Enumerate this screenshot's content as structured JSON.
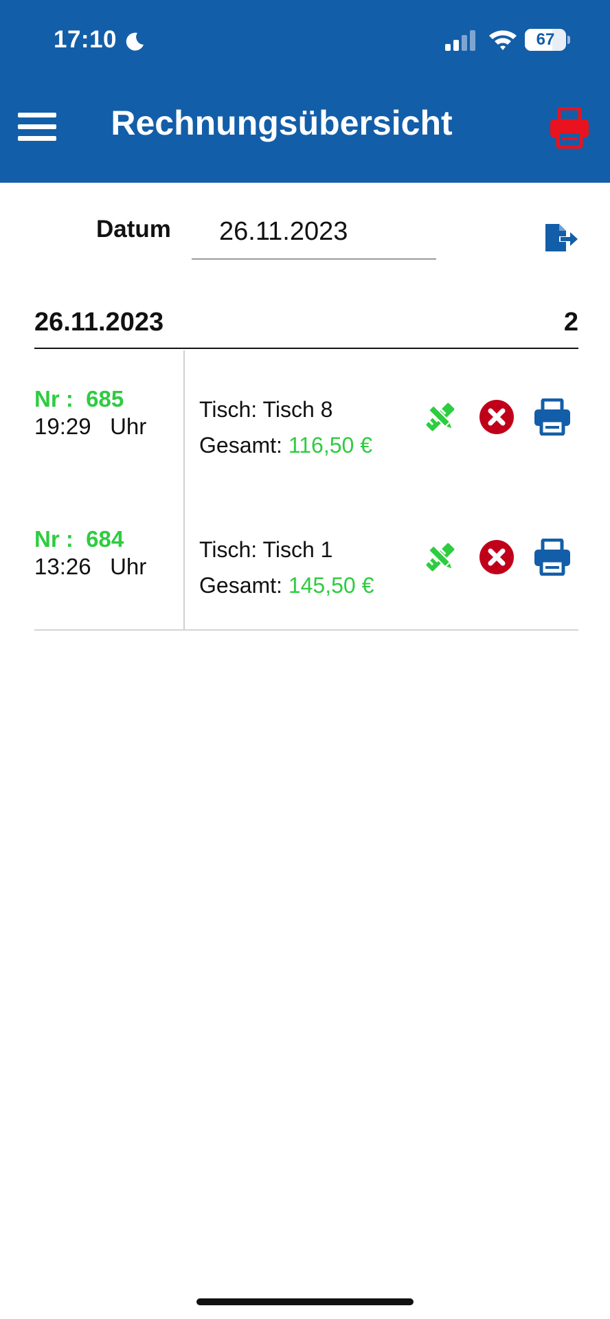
{
  "status_bar": {
    "time": "17:10",
    "battery": "67",
    "battery_level": 0.67
  },
  "header": {
    "title": "Rechnungsübersicht"
  },
  "filter": {
    "date_label": "Datum",
    "date_value": "26.11.2023"
  },
  "group": {
    "date": "26.11.2023",
    "count": "2"
  },
  "invoices": [
    {
      "nr": "Nr :  685",
      "time": "19:29   Uhr",
      "table": "Tisch: Tisch 8",
      "total_label": "Gesamt: ",
      "total_value": "116,50 €"
    },
    {
      "nr": "Nr :  684",
      "time": "13:26   Uhr",
      "table": "Tisch: Tisch 1",
      "total_label": "Gesamt: ",
      "total_value": "145,50 €"
    }
  ],
  "colors": {
    "header_blue": "#135ea8",
    "accent_green": "#2ecc40",
    "cancel_red": "#c0001a",
    "print_red": "#e8131f",
    "print_blue": "#135ea8"
  },
  "icons": {
    "menu": "menu-icon",
    "printer_header": "printer-icon",
    "export": "export-file-icon",
    "edit": "edit-icon",
    "cancel": "cancel-icon",
    "print": "printer-icon"
  }
}
